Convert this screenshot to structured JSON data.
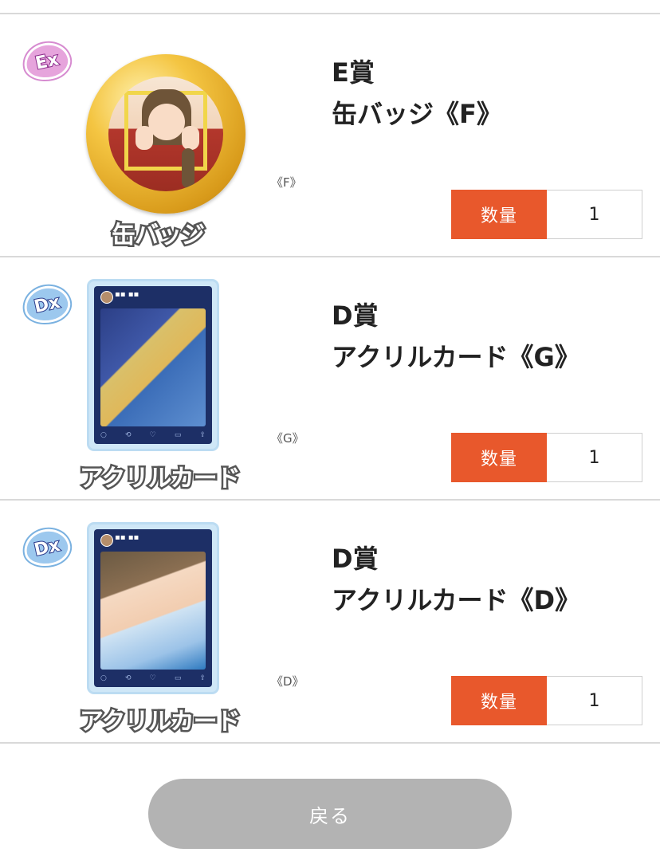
{
  "items": [
    {
      "rank_badge": "Ex",
      "badge_color": "#e6a4dc",
      "thumb_caption": "缶バッジ",
      "code": "《F》",
      "prize_rank": "E賞",
      "prize_name": "缶バッジ《F》",
      "qty_label": "数量",
      "qty_value": "1"
    },
    {
      "rank_badge": "Dx",
      "badge_color": "#9cc8ee",
      "thumb_caption": "アクリルカード",
      "code": "《G》",
      "prize_rank": "D賞",
      "prize_name": "アクリルカード《G》",
      "qty_label": "数量",
      "qty_value": "1"
    },
    {
      "rank_badge": "Dx",
      "badge_color": "#9cc8ee",
      "thumb_caption": "アクリルカード",
      "code": "《D》",
      "prize_rank": "D賞",
      "prize_name": "アクリルカード《D》",
      "qty_label": "数量",
      "qty_value": "1"
    }
  ],
  "colors": {
    "accent": "#e8582c",
    "button_disabled": "#b3b3b3",
    "divider": "#d9d9d9"
  },
  "back_button_label": "戻る"
}
